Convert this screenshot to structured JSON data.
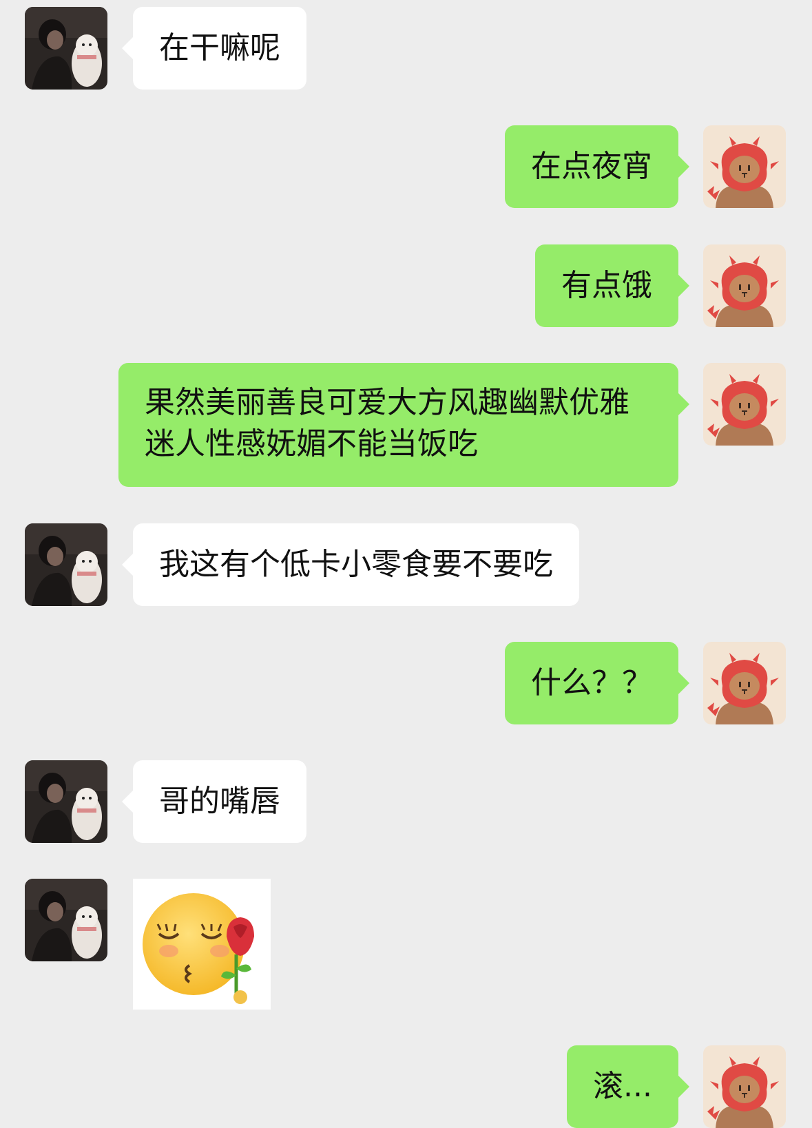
{
  "messages": [
    {
      "side": "in",
      "text": "在干嘛呢"
    },
    {
      "side": "out",
      "text": "在点夜宵"
    },
    {
      "side": "out",
      "text": "有点饿"
    },
    {
      "side": "out",
      "text": "果然美丽善良可爱大方风趣幽默优雅迷人性感妩媚不能当饭吃"
    },
    {
      "side": "in",
      "text": "我这有个低卡小零食要不要吃"
    },
    {
      "side": "out",
      "text": "什么？？"
    },
    {
      "side": "in",
      "text": "哥的嘴唇"
    },
    {
      "side": "in",
      "sticker": "blowing-kiss-rose-emoji"
    },
    {
      "side": "out",
      "text": "滚..."
    }
  ],
  "avatars": {
    "contact": "contact-avatar-person-with-dog",
    "self": "self-avatar-capybara-in-dragon-hood"
  },
  "colors": {
    "background": "#ededed",
    "incoming_bubble": "#ffffff",
    "outgoing_bubble": "#95ec69"
  }
}
